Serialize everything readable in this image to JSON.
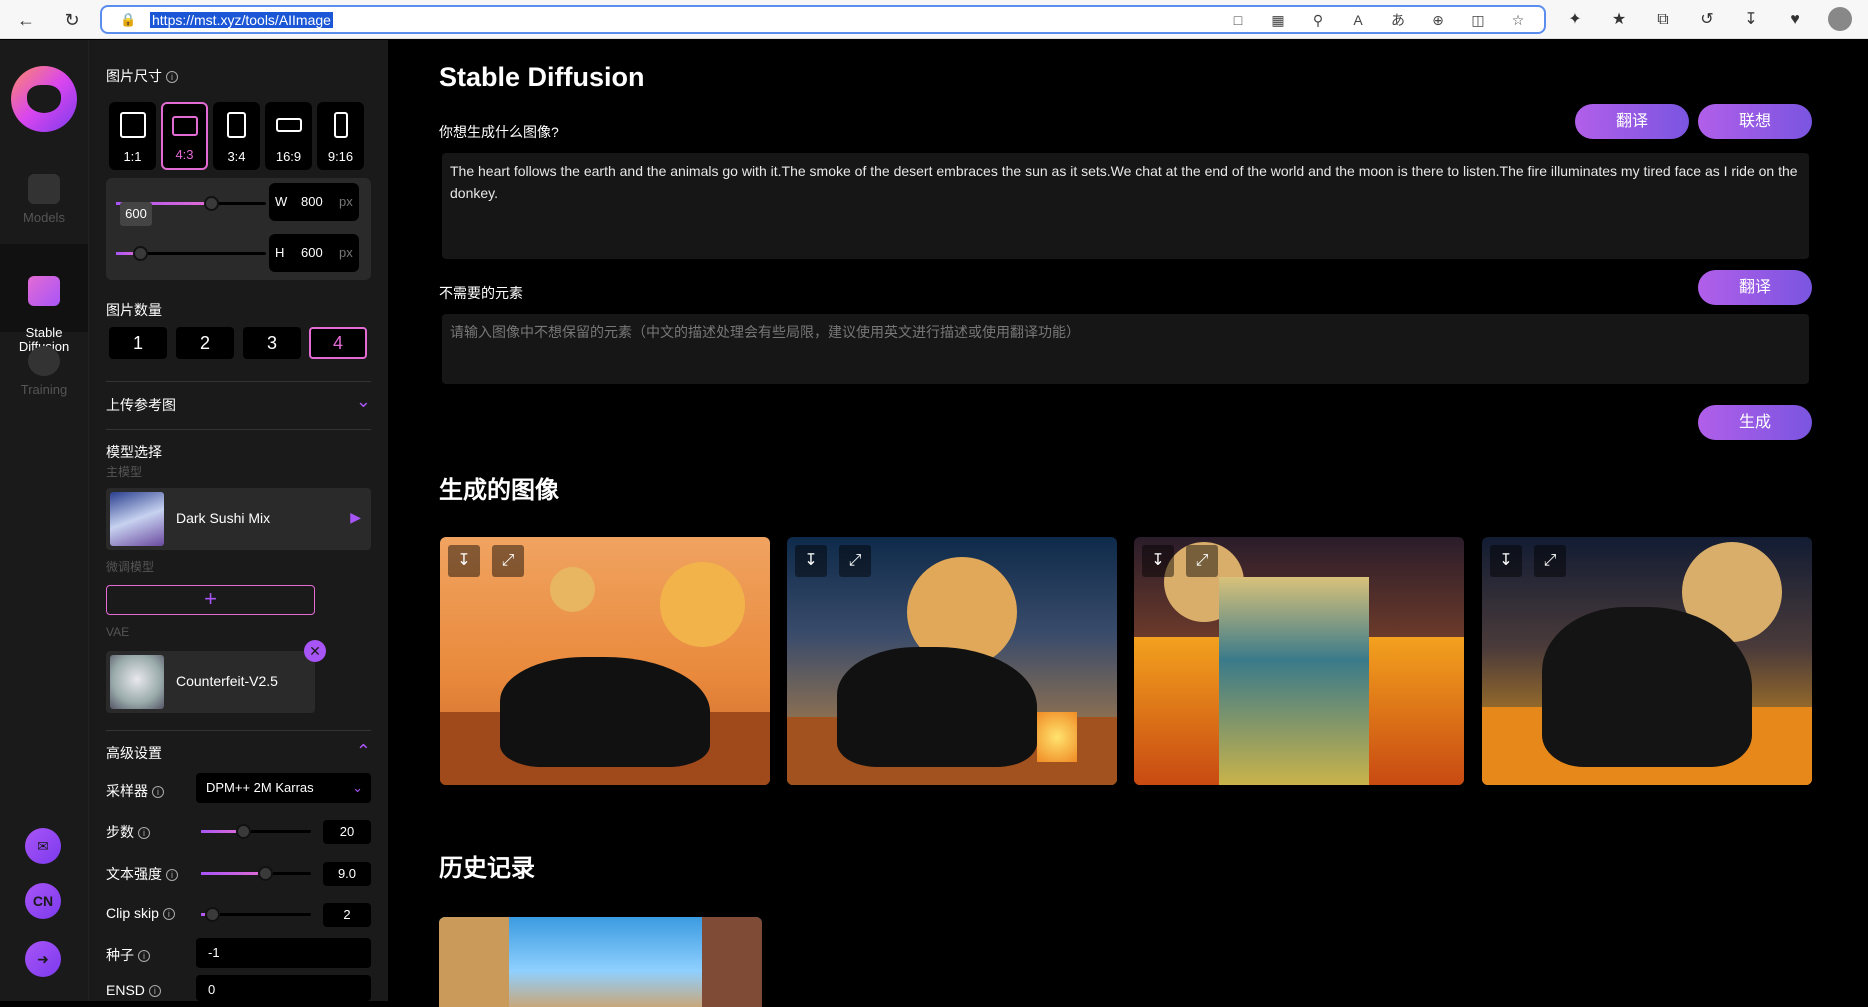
{
  "browser": {
    "url": "https://mst.xyz/tools/AIImage"
  },
  "rail": {
    "models": "Models",
    "sd": "Stable\nDiffusion",
    "training": "Training",
    "cn": "CN"
  },
  "panel": {
    "size_label": "图片尺寸",
    "ratios": [
      "1:1",
      "4:3",
      "3:4",
      "16:9",
      "9:16"
    ],
    "width_prefix": "W",
    "width_value": "800",
    "height_prefix": "H",
    "height_value": "600",
    "unit": "px",
    "tooltip": "600",
    "count_label": "图片数量",
    "counts": [
      "1",
      "2",
      "3",
      "4"
    ],
    "upload_label": "上传参考图",
    "model_label": "模型选择",
    "main_model_label": "主模型",
    "main_model": "Dark Sushi Mix",
    "finetune_label": "微调模型",
    "plus": "+",
    "vae_label": "VAE",
    "vae_model": "Counterfeit-V2.5",
    "advanced_label": "高级设置",
    "sampler_label": "采样器",
    "sampler": "DPM++ 2M Karras",
    "steps_label": "步数",
    "steps": "20",
    "cfg_label": "文本强度",
    "cfg": "9.0",
    "clip_label": "Clip skip",
    "clip": "2",
    "seed_label": "种子",
    "seed": "-1",
    "ensd_label": "ENSD",
    "ensd": "0",
    "sliders": {
      "width_fill": 0.63,
      "height_fill": 0.16,
      "steps_fill": 0.38,
      "cfg_fill": 0.58,
      "clip_fill": 0.1
    }
  },
  "main": {
    "title": "Stable Diffusion",
    "prompt_label": "你想生成什么图像?",
    "translate": "翻译",
    "associate": "联想",
    "prompt": "The heart follows the earth and the animals go with it.The smoke of the desert embraces the sun as it sets.We chat at the end of the world and the moon is there to listen.The fire illuminates my tired face as I ride on the donkey.",
    "negative_label": "不需要的元素",
    "negative_placeholder": "请输入图像中不想保留的元素（中文的描述处理会有些局限，建议使用英文进行描述或使用翻译功能）",
    "generate": "生成",
    "generated_title": "生成的图像",
    "history_title": "历史记录"
  },
  "colors": {
    "accent": "#e36bd4",
    "purple": "#a855f7"
  }
}
